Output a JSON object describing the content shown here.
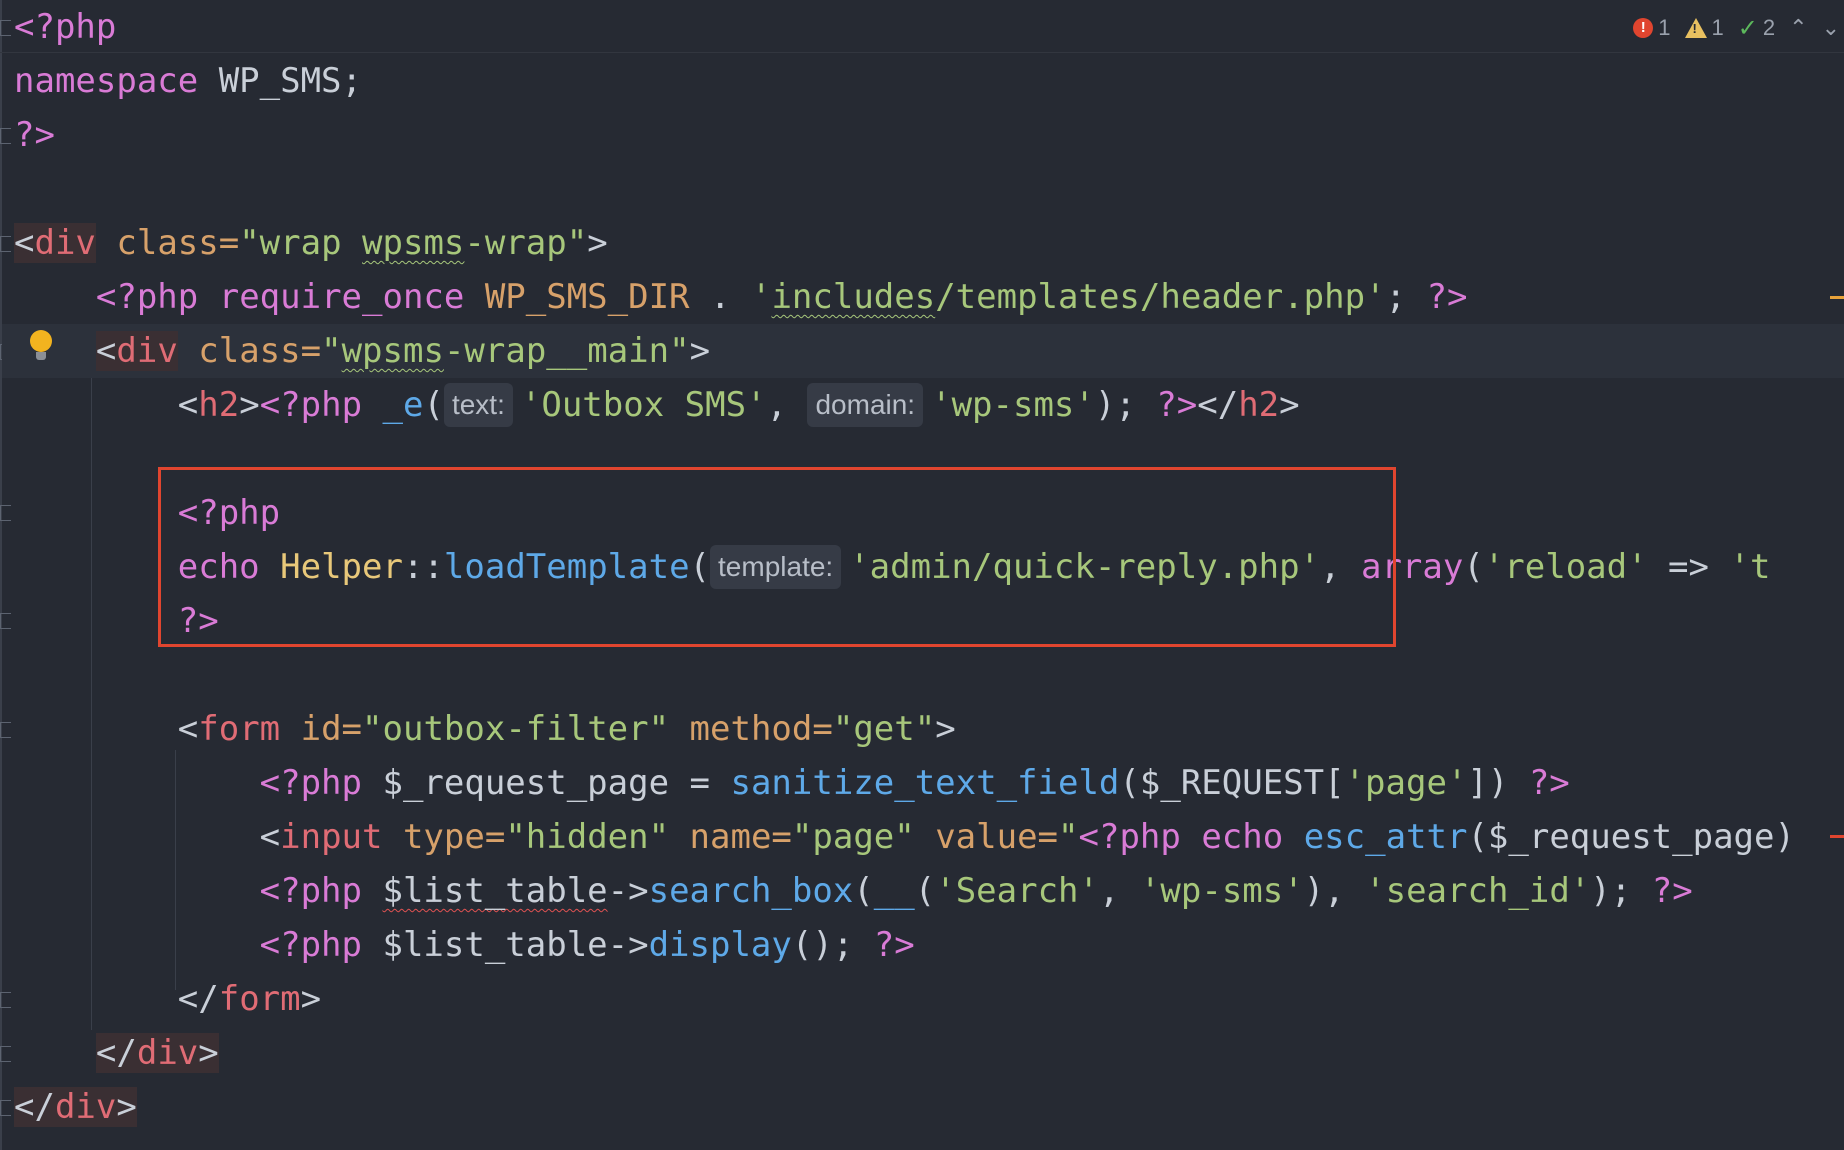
{
  "status": {
    "errors": "1",
    "warnings": "1",
    "checks": "2",
    "up_icon": "chevron-up-icon",
    "down_icon": "chevron-down-icon"
  },
  "hints": {
    "text": "text:",
    "domain": "domain:",
    "template": "template:"
  },
  "code": {
    "l1_open": "<?php",
    "l2_ns_kw": "namespace",
    "l2_ns_val": " WP_SMS;",
    "l3_close": "?>",
    "l5_lt": "<",
    "l5_tag": "div",
    "l5_attr": " class=",
    "l5_q1": "\"wrap ",
    "l5_sq": "wpsms",
    "l5_q2": "-wrap\"",
    "l5_gt": ">",
    "l6_open": "<?php ",
    "l6_req": "require_once",
    "l6_const": " WP_SMS_DIR ",
    "l6_dot": ". ",
    "l6_q1": "'",
    "l6_sq": "includes",
    "l6_q2": "/templates/header.php'",
    "l6_semi": "; ",
    "l6_close": "?>",
    "l7_lt": "<",
    "l7_tag": "div",
    "l7_attr": " class=",
    "l7_q1": "\"",
    "l7_sq": "wpsms",
    "l7_q2": "-wrap__main\"",
    "l7_gt": ">",
    "l8_lt": "<",
    "l8_tag": "h2",
    "l8_gt": ">",
    "l8_php": "<?php ",
    "l8_fn": "_e",
    "l8_paren": "(",
    "l8_s1": "'Outbox SMS'",
    "l8_comma": ", ",
    "l8_s2": "'wp-sms'",
    "l8_end": "); ",
    "l8_close": "?>",
    "l8_endtag_lt": "</",
    "l8_endtag": "h2",
    "l8_endtag_gt": ">",
    "l10_open": "<?php",
    "l11_echo": "echo ",
    "l11_cls": "Helper",
    "l11_dc": "::",
    "l11_fn": "loadTemplate",
    "l11_paren": "(",
    "l11_s1": "'admin/quick-reply.php'",
    "l11_comma": ", ",
    "l11_arr": "array",
    "l11_paren2": "(",
    "l11_s2": "'reload'",
    "l11_arrow": " => ",
    "l11_s3": "'t",
    "l12_close": "?>",
    "l14_lt": "<",
    "l14_tag": "form",
    "l14_a1": " id=",
    "l14_v1": "\"outbox-filter\"",
    "l14_a2": " method=",
    "l14_v2": "\"get\"",
    "l14_gt": ">",
    "l15_open": "<?php ",
    "l15_var": "$_request_page = ",
    "l15_fn": "sanitize_text_field",
    "l15_rest1": "($_REQUEST[",
    "l15_s": "'page'",
    "l15_rest2": "]) ",
    "l15_close": "?>",
    "l16_lt": "<",
    "l16_tag": "input",
    "l16_a1": " type=",
    "l16_v1": "\"hidden\"",
    "l16_a2": " name=",
    "l16_v2": "\"page\"",
    "l16_a3": " value=",
    "l16_v3": "\"",
    "l16_php": "<?php echo ",
    "l16_fn": "esc_attr",
    "l16_rest": "($_request_page)",
    "l17_open": "<?php ",
    "l17_var": "$list_table",
    "l17_arrow": "->",
    "l17_fn": "search_box",
    "l17_r1": "(",
    "l17_fn2": "__",
    "l17_r2": "(",
    "l17_s1": "'Search'",
    "l17_c1": ", ",
    "l17_s2": "'wp-sms'",
    "l17_r3": "), ",
    "l17_s3": "'search_id'",
    "l17_r4": "); ",
    "l17_close": "?>",
    "l18_open": "<?php ",
    "l18_var": "$list_table->",
    "l18_fn": "display",
    "l18_rest": "(); ",
    "l18_close": "?>",
    "l19_lt": "</",
    "l19_tag": "form",
    "l19_gt": ">",
    "l20_lt": "</",
    "l20_tag": "div",
    "l20_gt": ">",
    "l21_lt": "</",
    "l21_tag": "div",
    "l21_gt": ">"
  }
}
